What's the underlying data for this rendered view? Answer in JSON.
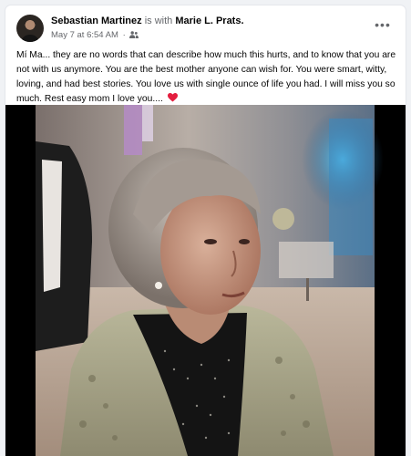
{
  "post": {
    "author": "Sebastian Martinez",
    "with_text": " is with ",
    "tagged": "Marie L. Prats.",
    "timestamp": "May 7 at 6:54 AM",
    "separator": "·",
    "audience_icon": "friends-icon",
    "more_label": "•••",
    "caption": "Mí Ma... they are no words that can describe how much this hurts, and to know that you are not with us anymore. You are the best mother anyone can wish for. You were smart, witty, loving, and had best stories. You love us with single ounce of life you had. I will miss you so much. Rest easy mom I love you....",
    "caption_emoji": "heart-icon"
  },
  "colors": {
    "heart": "#e41e3f",
    "link": "#050505",
    "secondary": "#65676b"
  }
}
